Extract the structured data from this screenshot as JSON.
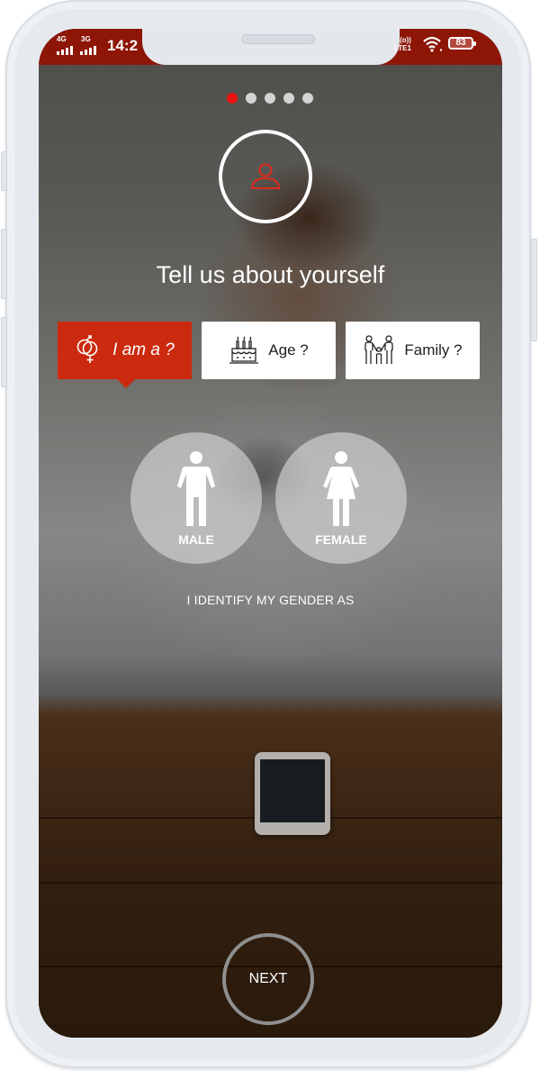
{
  "status_bar": {
    "network_1": "4G",
    "network_2": "3G",
    "time": "14:2",
    "volte_top": "(o))",
    "volte_bottom": "LTE1",
    "battery": "83",
    "background_color": "#8e1607"
  },
  "pager": {
    "total_steps": 5,
    "current_step": 1,
    "active_color": "#ea1313"
  },
  "header": {
    "avatar_icon": "person-outline-icon",
    "title": "Tell us about yourself"
  },
  "tabs": [
    {
      "label": "I am a ?",
      "icon": "gender-symbol-icon",
      "active": true
    },
    {
      "label": "Age ?",
      "icon": "birthday-cake-icon",
      "active": false
    },
    {
      "label": "Family ?",
      "icon": "family-icon",
      "active": false
    }
  ],
  "accent_color": "#cc2a0e",
  "gender_options": [
    {
      "label": "MALE",
      "icon": "male-figure-icon"
    },
    {
      "label": "FEMALE",
      "icon": "female-figure-icon"
    }
  ],
  "prompt": "I IDENTIFY MY GENDER AS",
  "next_button": {
    "label": "NEXT"
  }
}
